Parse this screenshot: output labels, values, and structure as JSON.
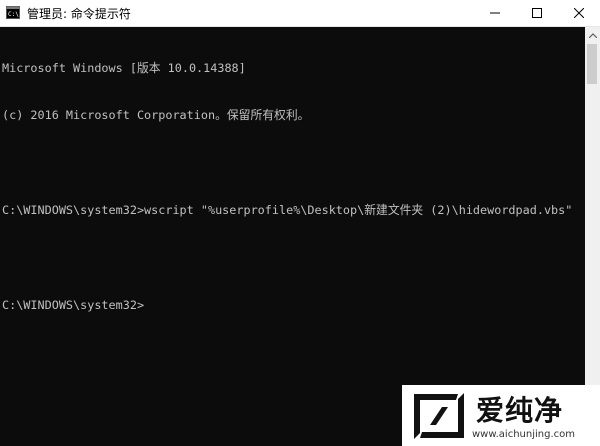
{
  "window": {
    "title": "管理员: 命令提示符",
    "minimize_glyph": "—",
    "maximize_glyph": "☐",
    "close_glyph": "✕"
  },
  "console": {
    "lines": [
      "Microsoft Windows [版本 10.0.14388]",
      "(c) 2016 Microsoft Corporation。保留所有权利。",
      "",
      "C:\\WINDOWS\\system32>wscript \"%userprofile%\\Desktop\\新建文件夹 (2)\\hidewordpad.vbs\"",
      "",
      "C:\\WINDOWS\\system32>"
    ]
  },
  "watermark": {
    "brand": "爱纯净",
    "url": "www.aichunjing.com"
  },
  "colors": {
    "console_bg": "#0c0c0c",
    "console_text": "#c0c0c0",
    "titlebar_bg": "#ffffff"
  }
}
